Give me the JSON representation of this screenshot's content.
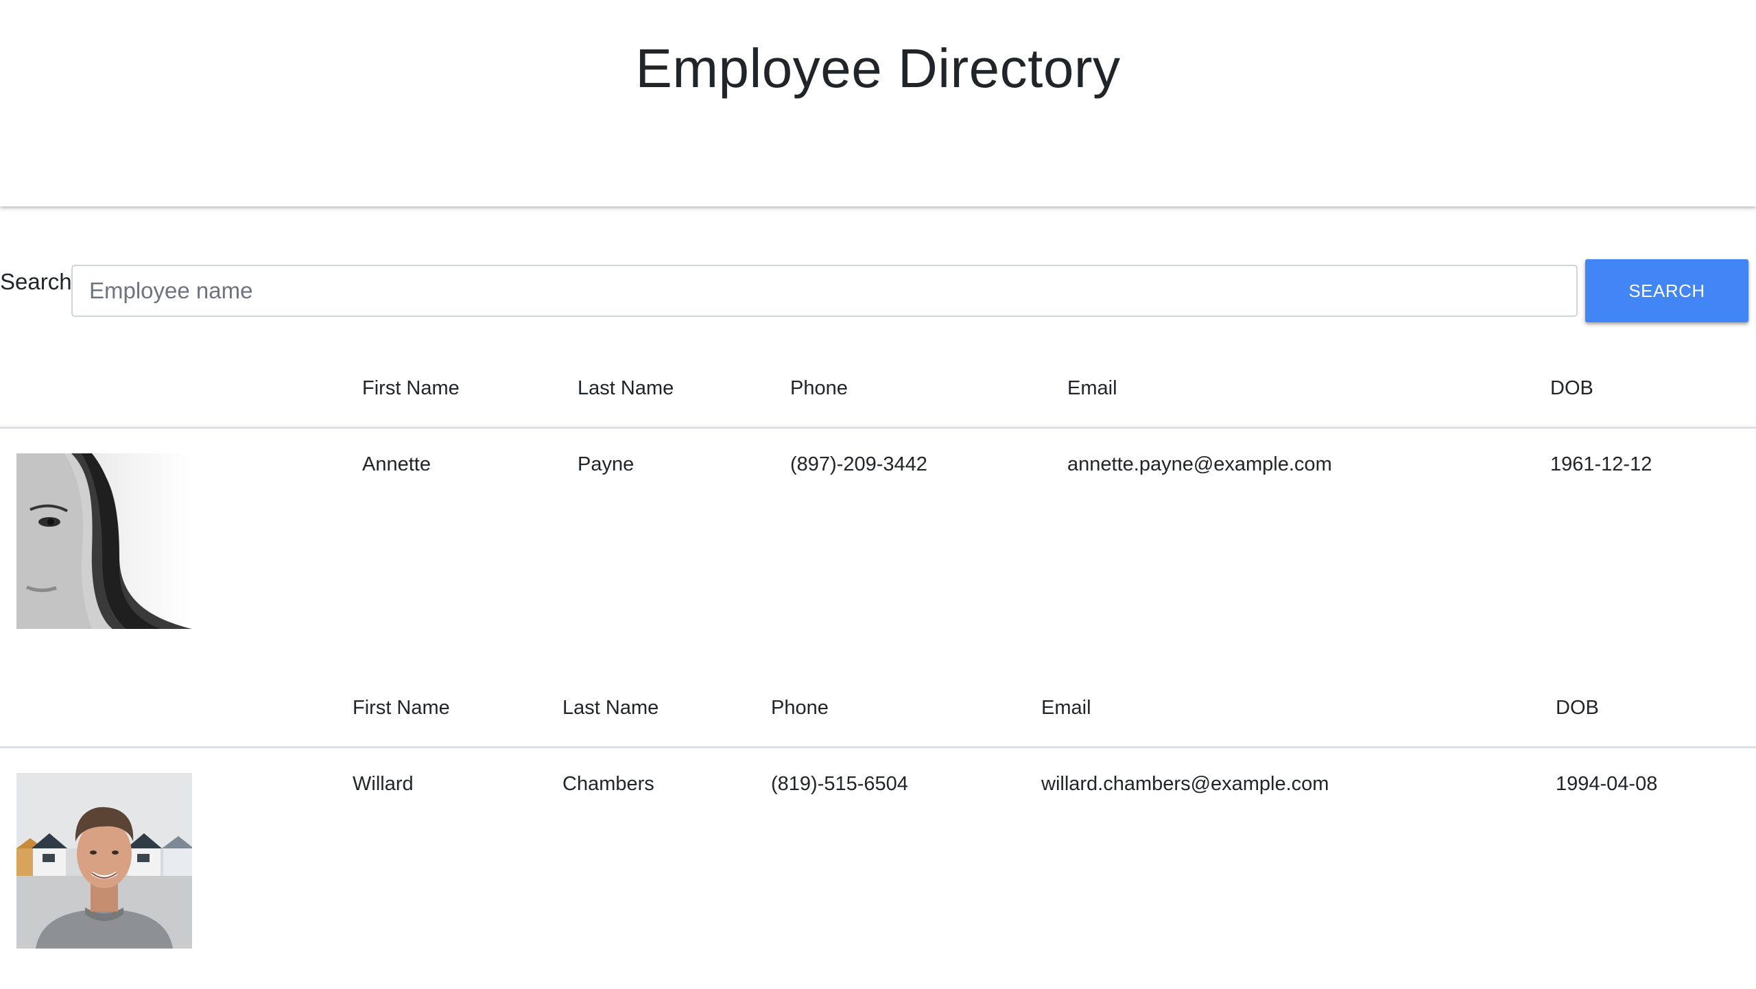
{
  "header": {
    "title": "Employee Directory"
  },
  "search": {
    "label": "Search:",
    "placeholder": "Employee name",
    "value": "",
    "button_label": "SEARCH"
  },
  "tables": [
    {
      "headers": [
        "First Name",
        "Last Name",
        "Phone",
        "Email",
        "DOB"
      ],
      "rows": [
        {
          "first_name": "Annette",
          "last_name": "Payne",
          "phone": "(897)-209-3442",
          "email": "annette.payne@example.com",
          "dob": "1961-12-12"
        }
      ]
    },
    {
      "headers": [
        "First Name",
        "Last Name",
        "Phone",
        "Email",
        "DOB"
      ],
      "rows": [
        {
          "first_name": "Willard",
          "last_name": "Chambers",
          "phone": "(819)-515-6504",
          "email": "willard.chambers@example.com",
          "dob": "1994-04-08"
        }
      ]
    }
  ],
  "colors": {
    "accent": "#4285f4",
    "text": "#212529",
    "border": "#dee2e6"
  },
  "icons": {
    "avatar_1": "employee-photo-woman",
    "avatar_2": "employee-photo-man"
  }
}
